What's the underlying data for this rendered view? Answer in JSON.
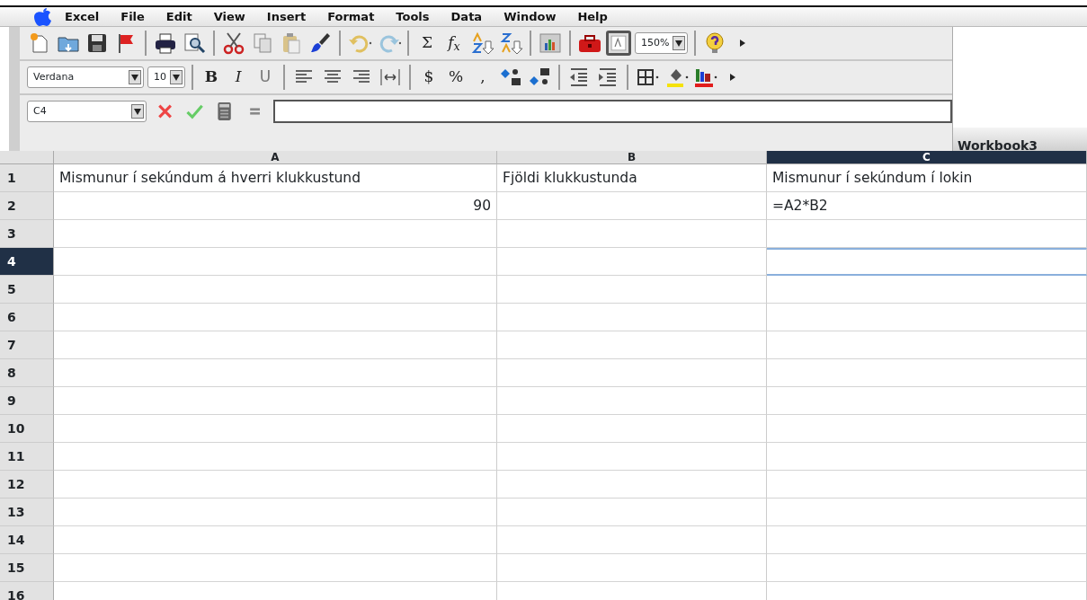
{
  "menu": [
    {
      "label": "Excel"
    },
    {
      "label": "File"
    },
    {
      "label": "Edit"
    },
    {
      "label": "View"
    },
    {
      "label": "Insert"
    },
    {
      "label": "Format"
    },
    {
      "label": "Tools"
    },
    {
      "label": "Data"
    },
    {
      "label": "Window"
    },
    {
      "label": "Help"
    }
  ],
  "toolbar_standard": [
    {
      "kind": "icon",
      "pressed": false
    },
    {
      "kind": "icon",
      "pressed": false
    },
    {
      "kind": "icon",
      "pressed": false
    },
    {
      "kind": "icon",
      "pressed": false
    },
    {
      "kind": "separator"
    },
    {
      "kind": "icon",
      "pressed": false
    },
    {
      "kind": "icon",
      "pressed": false
    },
    {
      "kind": "separator"
    },
    {
      "kind": "icon",
      "pressed": false
    },
    {
      "kind": "icon",
      "pressed": false
    },
    {
      "kind": "icon",
      "pressed": false
    },
    {
      "kind": "icon",
      "pressed": false
    },
    {
      "kind": "separator"
    },
    {
      "kind": "icon",
      "pressed": false
    },
    {
      "kind": "icon",
      "pressed": false
    },
    {
      "kind": "separator"
    },
    {
      "kind": "text",
      "label": "Σ"
    },
    {
      "kind": "text",
      "label": "f$_{x}$"
    },
    {
      "kind": "icon",
      "pressed": false
    },
    {
      "kind": "icon",
      "pressed": false
    },
    {
      "kind": "separator"
    },
    {
      "kind": "icon",
      "pressed": false
    },
    {
      "kind": "separator"
    },
    {
      "kind": "icon",
      "pressed": false
    },
    {
      "kind": "icon",
      "pressed": true
    },
    {
      "kind": "dropdown",
      "value": "150%"
    },
    {
      "kind": "separator"
    },
    {
      "kind": "icon",
      "pressed": false
    },
    {
      "kind": "icon",
      "pressed": false
    }
  ],
  "toolbar_formatting": [
    {
      "kind": "dropdown",
      "value": "Verdana"
    },
    {
      "kind": "dropdown",
      "value": "10"
    },
    {
      "kind": "separator"
    },
    {
      "kind": "text",
      "label": "B"
    },
    {
      "kind": "text",
      "label": "I"
    },
    {
      "kind": "text",
      "label": "U"
    },
    {
      "kind": "separator"
    },
    {
      "kind": "icon",
      "pressed": false
    },
    {
      "kind": "icon",
      "pressed": false
    },
    {
      "kind": "icon",
      "pressed": false
    },
    {
      "kind": "icon",
      "pressed": false
    },
    {
      "kind": "separator"
    },
    {
      "kind": "text",
      "label": "$"
    },
    {
      "kind": "text",
      "label": "%"
    },
    {
      "kind": "text",
      "label": ","
    },
    {
      "kind": "icon",
      "pressed": false
    },
    {
      "kind": "icon",
      "pressed": false
    },
    {
      "kind": "separator"
    },
    {
      "kind": "icon",
      "pressed": false
    },
    {
      "kind": "icon",
      "pressed": false
    },
    {
      "kind": "separator"
    },
    {
      "kind": "icon",
      "pressed": false
    },
    {
      "kind": "icon",
      "pressed": false
    },
    {
      "kind": "icon",
      "pressed": false
    },
    {
      "kind": "icon",
      "pressed": false
    }
  ],
  "formula_bar": {
    "name_box": "C4"
  },
  "window": {
    "title": "Workbook3"
  },
  "grid": {
    "columns": [
      {
        "label": "A",
        "selected": false
      },
      {
        "label": "B",
        "selected": false
      },
      {
        "label": "C",
        "selected": true
      }
    ],
    "rows": [
      {
        "label": "1",
        "selected": false,
        "cells": [
          {
            "kind": "text",
            "text": "Mismunur í sekúndum á hverri klukkustund"
          },
          {
            "kind": "text",
            "text": "Fjöldi klukkustunda"
          },
          {
            "kind": "text",
            "text": "Mismunur í sekúndum í lokin"
          }
        ]
      },
      {
        "label": "2",
        "selected": false,
        "cells": [
          {
            "kind": "number",
            "text": "90"
          },
          {
            "kind": "empty"
          },
          {
            "kind": "text",
            "text": "=A2*B2"
          }
        ]
      },
      {
        "label": "3",
        "selected": false
      },
      {
        "label": "4",
        "selected": true
      },
      {
        "label": "5",
        "selected": false
      },
      {
        "label": "6",
        "selected": false
      },
      {
        "label": "7",
        "selected": false
      },
      {
        "label": "8",
        "selected": false
      },
      {
        "label": "9",
        "selected": false
      },
      {
        "label": "10",
        "selected": false
      },
      {
        "label": "11",
        "selected": false
      },
      {
        "label": "12",
        "selected": false
      },
      {
        "label": "13",
        "selected": false
      },
      {
        "label": "14",
        "selected": false
      },
      {
        "label": "15",
        "selected": false
      },
      {
        "label": "16",
        "selected": false
      }
    ]
  }
}
